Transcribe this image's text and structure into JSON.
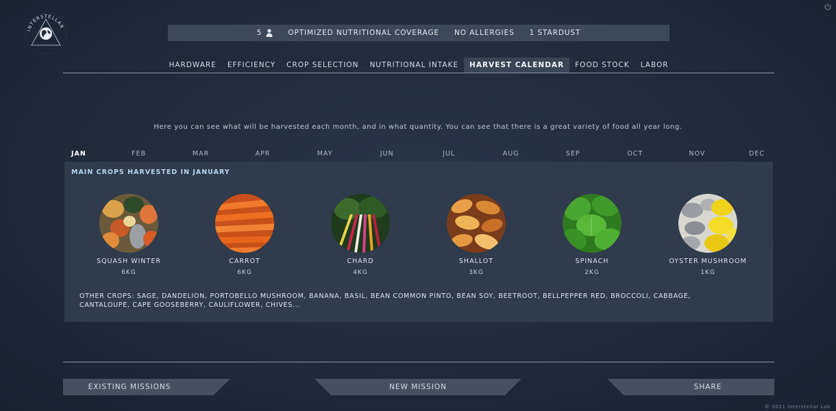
{
  "brand": {
    "name": "INTERSTELLAR"
  },
  "summary": {
    "crew_count": "5",
    "crew_icon": "person-icon",
    "coverage": "OPTIMIZED NUTRITIONAL COVERAGE",
    "allergies": "NO ALLERGIES",
    "stardust": "1 STARDUST"
  },
  "tabs": [
    {
      "label": "HARDWARE",
      "active": false
    },
    {
      "label": "EFFICIENCY",
      "active": false
    },
    {
      "label": "CROP SELECTION",
      "active": false
    },
    {
      "label": "NUTRITIONAL INTAKE",
      "active": false
    },
    {
      "label": "HARVEST CALENDAR",
      "active": true
    },
    {
      "label": "FOOD STOCK",
      "active": false
    },
    {
      "label": "LABOR",
      "active": false
    }
  ],
  "intro": "Here you can see what will be harvested each month, and in what quantity. You can see that there is a great variety of food all year long.",
  "months": [
    "JAN",
    "FEB",
    "MAR",
    "APR",
    "MAY",
    "JUN",
    "JUL",
    "AUG",
    "SEP",
    "OCT",
    "NOV",
    "DEC"
  ],
  "selected_month": "JAN",
  "panel": {
    "title": "MAIN CROPS HARVESTED IN JANUARY",
    "crops": [
      {
        "name": "SQUASH WINTER",
        "qty": "6KG"
      },
      {
        "name": "CARROT",
        "qty": "6KG"
      },
      {
        "name": "CHARD",
        "qty": "4KG"
      },
      {
        "name": "SHALLOT",
        "qty": "3KG"
      },
      {
        "name": "SPINACH",
        "qty": "2KG"
      },
      {
        "name": "OYSTER MUSHROOM",
        "qty": "1KG"
      }
    ],
    "other_crops": "OTHER CROPS: SAGE, DANDELION, PORTOBELLO MUSHROOM, BANANA, BASIL, BEAN COMMON PINTO, BEAN SOY, BEETROOT, BELLPEPPER RED, BROCCOLI, CABBAGE, CANTALOUPE, CAPE GOOSEBERRY, CAULIFLOWER, CHIVES..."
  },
  "buttons": {
    "existing": "EXISTING MISSIONS",
    "new": "NEW MISSION",
    "share": "SHARE"
  },
  "copyright": "© 2021 Interstellar Lab",
  "colors": {
    "accent_title": "#b8d4ee",
    "panel": "#303b4b",
    "bar": "#3d4858"
  }
}
